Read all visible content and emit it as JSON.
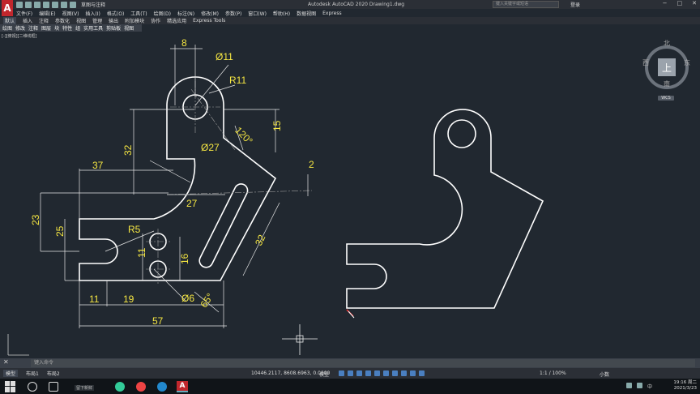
{
  "app": {
    "title": "Autodesk AutoCAD 2020   Drawing1.dwg",
    "logo": "A",
    "workspace": "草图与注释"
  },
  "search": {
    "placeholder": "键入关键字或短语"
  },
  "account": {
    "login": "登录"
  },
  "menu": [
    "文件(F)",
    "编辑(E)",
    "视图(V)",
    "插入(I)",
    "格式(O)",
    "工具(T)",
    "绘图(D)",
    "标注(N)",
    "修改(M)",
    "参数(P)",
    "窗口(W)",
    "帮助(H)",
    "数据视图",
    "Express"
  ],
  "ribbon_tabs": [
    "默认",
    "插入",
    "注释",
    "参数化",
    "视图",
    "管理",
    "输出",
    "附加模块",
    "协作",
    "精选应用",
    "Express Tools"
  ],
  "panels": [
    "绘图",
    "修改",
    "注释",
    "图层",
    "块",
    "特性",
    "组",
    "实用工具",
    "剪贴板",
    "视图"
  ],
  "viewport_label": "[-][俯视][二维线框]",
  "viewcube": {
    "north": "北",
    "south": "南",
    "east": "东",
    "west": "西",
    "face": "上",
    "wcs": "WCS"
  },
  "dimensions": {
    "d8": "8",
    "d11": "Ø11",
    "r11": "R11",
    "a120": "120°",
    "d15": "15",
    "d32a": "32",
    "d27dia": "Ø27",
    "d37": "37",
    "d2": "2",
    "d27": "27",
    "d23": "23",
    "d25": "25",
    "r5": "R5",
    "d11b": "11",
    "d16": "16",
    "d32b": "32",
    "d11c": "11",
    "d19": "19",
    "d6": "Ø6",
    "a65": "65°",
    "d57": "57"
  },
  "command": {
    "placeholder": "键入命令"
  },
  "layouts": [
    "模型",
    "布局1",
    "布局2"
  ],
  "status": {
    "coords": "10446.2117, 8608.6963, 0.0000",
    "model": "模型",
    "scale": "1:1 / 100%",
    "units": "小数"
  },
  "taskbar": {
    "note": "留下新鲜",
    "time": "19:16 周二",
    "date": "2021/3/23",
    "ime": "中"
  }
}
